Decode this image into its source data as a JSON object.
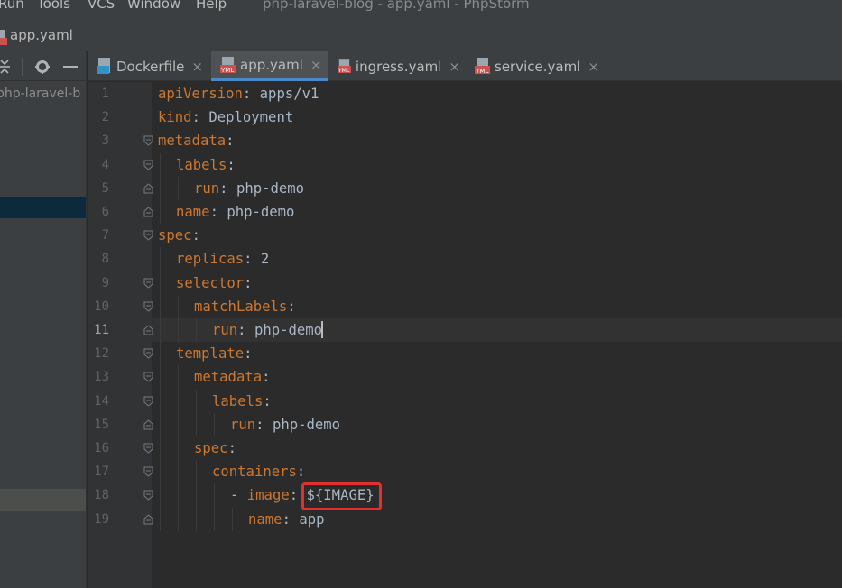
{
  "menu": {
    "items": [
      "Run",
      "Tools",
      "VCS",
      "Window",
      "Help"
    ],
    "mnemonics": [
      "R",
      "T",
      "C",
      "W",
      "H"
    ],
    "window_title": "php-laravel-blog - app.yaml - PhpStorm"
  },
  "navbar": {
    "breadcrumb": "app.yaml",
    "icon": "yml-file-icon"
  },
  "project_panel": {
    "root_label": "php-laravel-b",
    "toolbar_icons": [
      "collapse-all-icon",
      "gear-icon",
      "hide-icon"
    ]
  },
  "tabs": [
    {
      "label": "Dockerfile",
      "icon": "docker-file-icon",
      "active": false
    },
    {
      "label": "app.yaml",
      "icon": "yml-file-icon",
      "active": true
    },
    {
      "label": "ingress.yaml",
      "icon": "yml-file-icon",
      "active": false
    },
    {
      "label": "service.yaml",
      "icon": "yml-file-icon",
      "active": false
    }
  ],
  "tab_close_glyph": "×",
  "editor": {
    "current_line": 11,
    "highlighted_value": "${IMAGE}",
    "highlight_color": "#e03030",
    "lines": [
      {
        "n": "1",
        "indent": 0,
        "key": "apiVersion",
        "value": "apps/v1",
        "fold": ""
      },
      {
        "n": "2",
        "indent": 0,
        "key": "kind",
        "value": "Deployment",
        "fold": ""
      },
      {
        "n": "3",
        "indent": 0,
        "key": "metadata",
        "value": "",
        "fold": "open"
      },
      {
        "n": "4",
        "indent": 1,
        "key": "labels",
        "value": "",
        "fold": "open"
      },
      {
        "n": "5",
        "indent": 2,
        "key": "run",
        "value": "php-demo",
        "fold": "close"
      },
      {
        "n": "6",
        "indent": 1,
        "key": "name",
        "value": "php-demo",
        "fold": "close"
      },
      {
        "n": "7",
        "indent": 0,
        "key": "spec",
        "value": "",
        "fold": "open"
      },
      {
        "n": "8",
        "indent": 1,
        "key": "replicas",
        "value": "2",
        "fold": ""
      },
      {
        "n": "9",
        "indent": 1,
        "key": "selector",
        "value": "",
        "fold": "open"
      },
      {
        "n": "10",
        "indent": 2,
        "key": "matchLabels",
        "value": "",
        "fold": "open"
      },
      {
        "n": "11",
        "indent": 3,
        "key": "run",
        "value": "php-demo",
        "fold": "close"
      },
      {
        "n": "12",
        "indent": 1,
        "key": "template",
        "value": "",
        "fold": "open"
      },
      {
        "n": "13",
        "indent": 2,
        "key": "metadata",
        "value": "",
        "fold": "open"
      },
      {
        "n": "14",
        "indent": 3,
        "key": "labels",
        "value": "",
        "fold": "open"
      },
      {
        "n": "15",
        "indent": 4,
        "key": "run",
        "value": "php-demo",
        "fold": "close"
      },
      {
        "n": "16",
        "indent": 2,
        "key": "spec",
        "value": "",
        "fold": "open"
      },
      {
        "n": "17",
        "indent": 3,
        "key": "containers",
        "value": "",
        "fold": "open"
      },
      {
        "n": "18",
        "indent": 4,
        "dash": true,
        "key": "image",
        "value": "${IMAGE}",
        "fold": "open"
      },
      {
        "n": "19",
        "indent": 5,
        "key": "name",
        "value": "app",
        "fold": "close"
      }
    ]
  },
  "colors": {
    "key": "#cc7832",
    "text": "#a9b7c6",
    "background": "#2b2b2b",
    "active_tab_underline": "#4a88c7"
  }
}
